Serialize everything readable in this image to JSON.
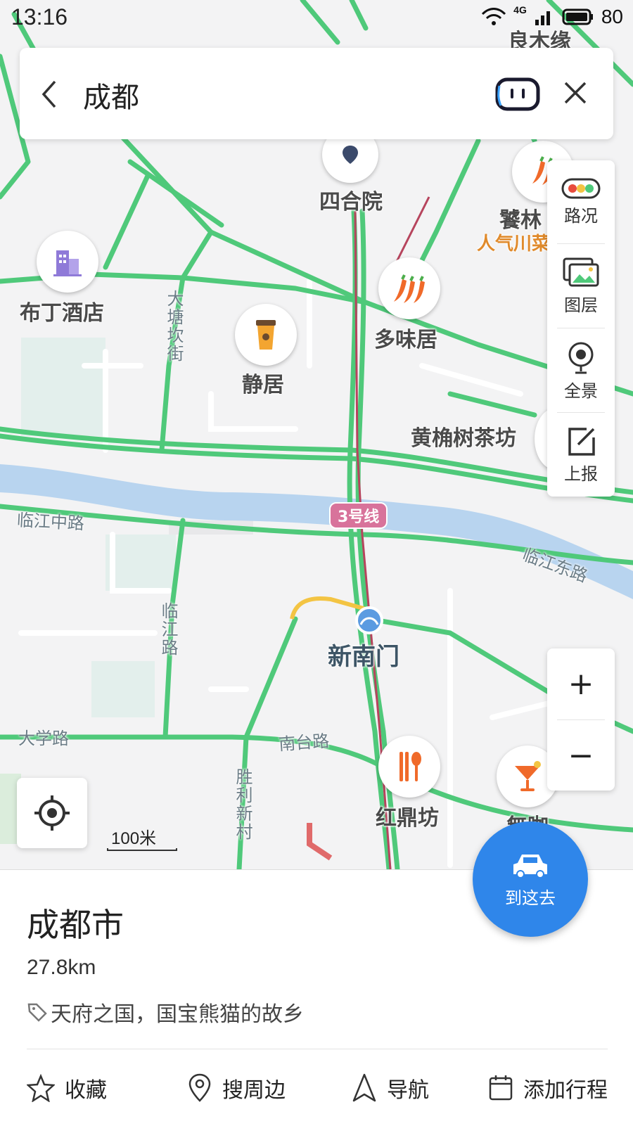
{
  "status_bar": {
    "time": "13:16",
    "network": "4G",
    "battery": "80"
  },
  "search": {
    "query": "成都"
  },
  "map": {
    "pois": [
      {
        "name": "四合院",
        "icon": "pin-icon"
      },
      {
        "name": "饕林",
        "subtitle": "人气川菜",
        "icon": "chili-icon"
      },
      {
        "name": "布丁酒店",
        "icon": "hotel-icon"
      },
      {
        "name": "多味居",
        "icon": "chili-icon"
      },
      {
        "name": "静居",
        "icon": "coffee-icon"
      },
      {
        "name": "黄桷树茶坊",
        "icon": "tea-icon"
      },
      {
        "name": "红鼎坊",
        "icon": "restaurant-icon"
      },
      {
        "name": "無咖",
        "icon": "cocktail-icon"
      },
      {
        "name": "良木缘",
        "icon": "coffee-icon"
      }
    ],
    "streets": [
      "大塘坎街",
      "临江中路",
      "临江东路",
      "临江路",
      "大学路",
      "南台路",
      "胜利新村"
    ],
    "metro": {
      "line_label": "3号线",
      "station": "新南门"
    },
    "scale": "100米"
  },
  "tools": [
    {
      "label": "路况",
      "icon": "traffic-light-icon"
    },
    {
      "label": "图层",
      "icon": "layers-icon"
    },
    {
      "label": "全景",
      "icon": "panorama-icon"
    },
    {
      "label": "上报",
      "icon": "report-icon"
    }
  ],
  "zoom": {
    "in": "+",
    "out": "−"
  },
  "place": {
    "name": "成都市",
    "distance": "27.8km",
    "tagline": "天府之国，国宝熊猫的故乡"
  },
  "goto_label": "到这去",
  "actions": [
    {
      "label": "收藏",
      "icon": "star-icon"
    },
    {
      "label": "搜周边",
      "icon": "location-pin-icon"
    },
    {
      "label": "导航",
      "icon": "navigation-icon"
    },
    {
      "label": "添加行程",
      "icon": "calendar-icon"
    }
  ],
  "colors": {
    "road": "#4fc97a",
    "river": "#b8d4ef",
    "accent": "#2f86ea",
    "metro": "#d8739b"
  }
}
